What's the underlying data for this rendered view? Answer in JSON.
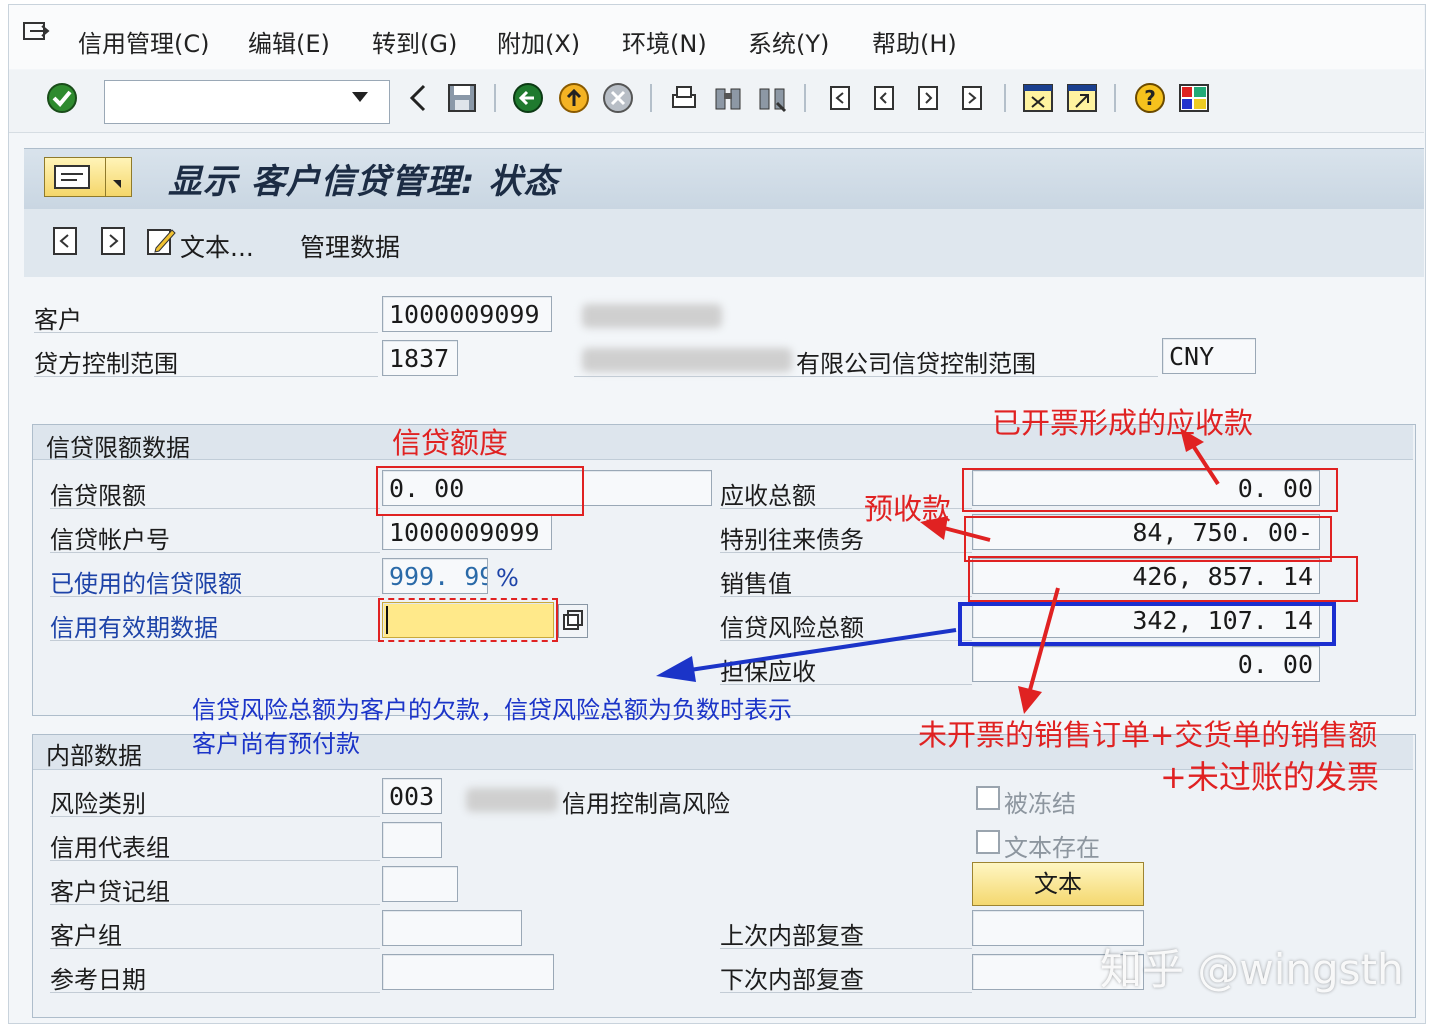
{
  "menu": {
    "items": [
      {
        "label": "信用管理(C)"
      },
      {
        "label": "编辑(E)"
      },
      {
        "label": "转到(G)"
      },
      {
        "label": "附加(X)"
      },
      {
        "label": "环境(N)"
      },
      {
        "label": "系统(Y)"
      },
      {
        "label": "帮助(H)"
      }
    ]
  },
  "toolbar": {
    "command_value": "",
    "icons": [
      "enter-check-icon",
      "back-arrow-icon",
      "save-icon",
      "back-icon",
      "exit-icon",
      "cancel-icon",
      "print-icon",
      "find-icon",
      "find-next-icon",
      "first-page-icon",
      "prev-page-icon",
      "next-page-icon",
      "last-page-icon",
      "new-session-icon",
      "shortcut-icon",
      "help-icon",
      "layout-icon"
    ]
  },
  "title": {
    "text": "显示 客户信贷管理: 状态"
  },
  "appbar": {
    "text_button": "文本...",
    "admin_data": "管理数据"
  },
  "header": {
    "customer_label": "客户",
    "customer_value": "1000009099",
    "credit_area_label": "贷方控制范围",
    "credit_area_value": "1837",
    "credit_area_desc": "有限公司信贷控制范围",
    "currency": "CNY"
  },
  "credit_limit": {
    "title": "信贷限额数据",
    "limit_label": "信贷限额",
    "limit_value": "0. 00",
    "account_label": "信贷帐户号",
    "account_value": "1000009099",
    "used_label": "已使用的信贷限额",
    "used_value": "999. 99",
    "used_unit": "%",
    "validity_label": "信用有效期数据",
    "validity_value": "",
    "receivables_label": "应收总额",
    "receivables_value": "0. 00",
    "special_label": "特别往来债务",
    "special_value": "84, 750. 00-",
    "sales_label": "销售值",
    "sales_value": "426, 857. 14",
    "exposure_label": "信贷风险总额",
    "exposure_value": "342, 107. 14",
    "secured_label": "担保应收",
    "secured_value": "0. 00"
  },
  "internal": {
    "title": "内部数据",
    "risk_label": "风险类别",
    "risk_value": "003",
    "risk_desc": "信用控制高风险",
    "rep_label": "信用代表组",
    "rep_value": "",
    "clerk_label": "客户贷记组",
    "clerk_value": "",
    "group_label": "客户组",
    "group_value": "",
    "ref_date_label": "参考日期",
    "ref_date_value": "",
    "blocked_label": "被冻结",
    "text_exists_label": "文本存在",
    "text_button": "文本",
    "last_review_label": "上次内部复查",
    "last_review_value": "",
    "next_review_label": "下次内部复查",
    "next_review_value": ""
  },
  "annotations": {
    "credit_quota": "信贷额度",
    "invoiced_receivable": "已开票形成的应收款",
    "prepayment": "预收款",
    "exposure_note_1": "信贷风险总额为客户的欠款，信贷风险总额为负数时表示",
    "exposure_note_2": "客户尚有预付款",
    "sales_note_1": "未开票的销售订单+交货单的销售额",
    "sales_note_2": "+未过账的发票"
  },
  "watermark": "知乎 @wingsth",
  "colors": {
    "annotation_red": "#e02222",
    "annotation_blue": "#1b34c8",
    "link_blue": "#1d43a8",
    "title_bar": "#c9d6e2"
  }
}
